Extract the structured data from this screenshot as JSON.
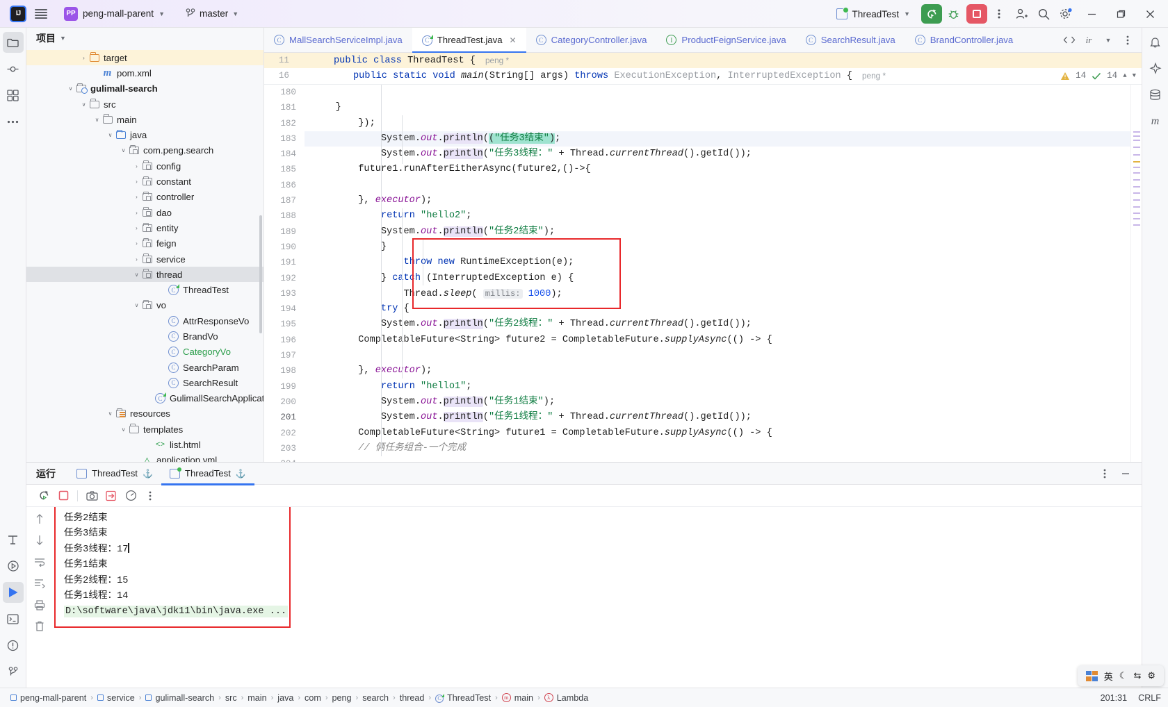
{
  "titlebar": {
    "logo": "IJ",
    "project": "peng-mall-parent",
    "branch": "master",
    "run_config": "ThreadTest",
    "icons": [
      "run-icon",
      "debug-icon",
      "stop-icon",
      "more-actions-icon",
      "add-user-icon",
      "search-icon",
      "settings-icon"
    ],
    "window": {
      "minimize": "─",
      "maximize": "❐",
      "close": "✕"
    }
  },
  "left_rail": {
    "items": [
      {
        "name": "project-tool-window",
        "glyph": "folder"
      },
      {
        "name": "commit-tool-window",
        "glyph": "commit"
      },
      {
        "name": "structure-tool-window",
        "glyph": "structure"
      },
      {
        "name": "more-tool-windows",
        "glyph": "dots"
      }
    ],
    "bottom_items": [
      {
        "name": "terminal-tool-window",
        "glyph": "T"
      },
      {
        "name": "services-tool-window",
        "glyph": "play-circle"
      },
      {
        "name": "run-tool-window",
        "glyph": "play-filled"
      },
      {
        "name": "debug-console",
        "glyph": "console"
      },
      {
        "name": "problems-tool-window",
        "glyph": "warn"
      },
      {
        "name": "git-tool-window",
        "glyph": "branch"
      }
    ]
  },
  "right_rail": {
    "items": [
      {
        "name": "notifications",
        "glyph": "bell"
      },
      {
        "name": "ai-assistant",
        "glyph": "ai"
      },
      {
        "name": "database-tool-window",
        "glyph": "db"
      },
      {
        "name": "maven-tool-window",
        "glyph": "m"
      }
    ]
  },
  "project_panel": {
    "title": "项目",
    "tree": [
      {
        "indent": 4,
        "arrow": "›",
        "icon": "folder-orange",
        "label": "target",
        "highlight": true
      },
      {
        "indent": 5,
        "arrow": "",
        "icon": "maven",
        "label": "pom.xml"
      },
      {
        "indent": 3,
        "arrow": "∨",
        "icon": "module",
        "label": "gulimall-search",
        "bold": true
      },
      {
        "indent": 4,
        "arrow": "∨",
        "icon": "folder",
        "label": "src"
      },
      {
        "indent": 5,
        "arrow": "∨",
        "icon": "folder",
        "label": "main"
      },
      {
        "indent": 6,
        "arrow": "∨",
        "icon": "folder-blue",
        "label": "java"
      },
      {
        "indent": 7,
        "arrow": "∨",
        "icon": "package",
        "label": "com.peng.search"
      },
      {
        "indent": 8,
        "arrow": "›",
        "icon": "package",
        "label": "config"
      },
      {
        "indent": 8,
        "arrow": "›",
        "icon": "package",
        "label": "constant"
      },
      {
        "indent": 8,
        "arrow": "›",
        "icon": "package",
        "label": "controller"
      },
      {
        "indent": 8,
        "arrow": "›",
        "icon": "package",
        "label": "dao"
      },
      {
        "indent": 8,
        "arrow": "›",
        "icon": "package",
        "label": "entity"
      },
      {
        "indent": 8,
        "arrow": "›",
        "icon": "package",
        "label": "feign"
      },
      {
        "indent": 8,
        "arrow": "›",
        "icon": "package",
        "label": "service"
      },
      {
        "indent": 8,
        "arrow": "∨",
        "icon": "package",
        "label": "thread",
        "selected": true
      },
      {
        "indent": 10,
        "arrow": "",
        "icon": "runnable-class",
        "label": "ThreadTest"
      },
      {
        "indent": 8,
        "arrow": "∨",
        "icon": "package",
        "label": "vo"
      },
      {
        "indent": 10,
        "arrow": "",
        "icon": "class",
        "label": "AttrResponseVo"
      },
      {
        "indent": 10,
        "arrow": "",
        "icon": "class",
        "label": "BrandVo"
      },
      {
        "indent": 10,
        "arrow": "",
        "icon": "class",
        "label": "CategoryVo",
        "green": true
      },
      {
        "indent": 10,
        "arrow": "",
        "icon": "class",
        "label": "SearchParam"
      },
      {
        "indent": 10,
        "arrow": "",
        "icon": "class",
        "label": "SearchResult"
      },
      {
        "indent": 9,
        "arrow": "",
        "icon": "spring-app",
        "label": "GulimallSearchApplication"
      },
      {
        "indent": 6,
        "arrow": "∨",
        "icon": "resources",
        "label": "resources"
      },
      {
        "indent": 7,
        "arrow": "∨",
        "icon": "folder",
        "label": "templates"
      },
      {
        "indent": 9,
        "arrow": "",
        "icon": "html",
        "label": "list.html"
      },
      {
        "indent": 8,
        "arrow": "",
        "icon": "yaml",
        "label": "application.yml"
      }
    ]
  },
  "editor": {
    "tabs": [
      {
        "label": "MallSearchServiceImpl.java",
        "icon": "class",
        "active": false
      },
      {
        "label": "ThreadTest.java",
        "icon": "runnable-class",
        "active": true,
        "closable": true
      },
      {
        "label": "CategoryController.java",
        "icon": "class",
        "active": false
      },
      {
        "label": "ProductFeignService.java",
        "icon": "interface",
        "active": false
      },
      {
        "label": "SearchResult.java",
        "icon": "class",
        "active": false
      },
      {
        "label": "BrandController.java",
        "icon": "class",
        "active": false
      }
    ],
    "sticky_lines": [
      {
        "num": "11",
        "text": "public class ThreadTest {",
        "author": "peng *"
      },
      {
        "num": "16",
        "text": "public static void main(String[] args) throws ExecutionException, InterruptedException {",
        "author": "peng *"
      }
    ],
    "inspections": {
      "warnings": "14",
      "checks": "14"
    },
    "lines": [
      {
        "num": "180",
        "html": ""
      },
      {
        "num": "181",
        "html": "        <span class=\"cmt\">// 俩任务组合-一个完成</span>"
      },
      {
        "num": "182",
        "html": "        CompletableFuture&lt;String&gt; future1 = CompletableFuture.<span class=\"mth-i\">supplyAsync</span>(() -&gt; {"
      },
      {
        "num": "183",
        "html": "            System.<span class=\"fld\">out</span>.<span class=\"hl-id\">println</span>(<span class=\"str\">\"任务1线程：\"</span> + Thread.<span class=\"mth-i\">currentThread</span>().getId());"
      },
      {
        "num": "184",
        "html": "            System.<span class=\"fld\">out</span>.<span class=\"hl-id\">println</span>(<span class=\"str\">\"任务1结束\"</span>);"
      },
      {
        "num": "185",
        "html": "            <span class=\"kw\">return</span> <span class=\"str\">\"hello1\"</span>;"
      },
      {
        "num": "186",
        "html": "        }, <span class=\"fld\">executor</span>);"
      },
      {
        "num": "187",
        "html": ""
      },
      {
        "num": "188",
        "html": "        CompletableFuture&lt;String&gt; future2 = CompletableFuture.<span class=\"mth-i\">supplyAsync</span>(() -&gt; {"
      },
      {
        "num": "189",
        "html": "            System.<span class=\"fld\">out</span>.<span class=\"hl-id\">println</span>(<span class=\"str\">\"任务2线程：\"</span> + Thread.<span class=\"mth-i\">currentThread</span>().getId());"
      },
      {
        "num": "190",
        "html": "            <span class=\"kw\">try</span> {"
      },
      {
        "num": "191",
        "html": "                Thread.<span class=\"mth-i\">sleep</span>( <span class=\"hint\">millis:</span> <span class=\"num\">1000</span>);"
      },
      {
        "num": "192",
        "html": "            } <span class=\"kw\">catch</span> (InterruptedException e) {"
      },
      {
        "num": "193",
        "html": "                <span class=\"kw\">throw new</span> RuntimeException(e);"
      },
      {
        "num": "194",
        "html": "            }"
      },
      {
        "num": "195",
        "html": "            System.<span class=\"fld\">out</span>.<span class=\"hl-id\">println</span>(<span class=\"str\">\"任务2结束\"</span>);"
      },
      {
        "num": "196",
        "html": "            <span class=\"kw\">return</span> <span class=\"str\">\"hello2\"</span>;"
      },
      {
        "num": "197",
        "html": "        }, <span class=\"fld\">executor</span>);"
      },
      {
        "num": "198",
        "html": ""
      },
      {
        "num": "199",
        "html": "        future1.runAfterEitherAsync(future2,()-&gt;{"
      },
      {
        "num": "200",
        "html": "            System.<span class=\"fld\">out</span>.<span class=\"hl-id\">println</span>(<span class=\"str\">\"任务3线程：\"</span> + Thread.<span class=\"mth-i\">currentThread</span>().getId());"
      },
      {
        "num": "201",
        "html": "            System.<span class=\"fld\">out</span>.<span class=\"hl-id\">println</span>(<span class=\"sel-txt\">(<span class=\"str\">\"任务3结束\"</span>)</span>;",
        "current": true
      },
      {
        "num": "202",
        "html": "        });"
      },
      {
        "num": "203",
        "html": "    }"
      },
      {
        "num": "204",
        "html": ""
      }
    ]
  },
  "run_panel": {
    "title": "运行",
    "tabs": [
      {
        "label": "ThreadTest",
        "active": false,
        "live": false
      },
      {
        "label": "ThreadTest",
        "active": true,
        "live": true
      }
    ],
    "toolbar_icons": [
      "rerun-icon",
      "stop-icon",
      "screenshot-icon",
      "export-icon",
      "profiler-icon",
      "more-icon"
    ],
    "console_rail_icons": [
      "scroll-up-icon",
      "scroll-down-icon",
      "soft-wrap-icon",
      "scroll-to-end-icon",
      "print-icon",
      "trash-icon"
    ],
    "console": [
      {
        "text": "D:\\software\\java\\jdk11\\bin\\java.exe ...",
        "cmd": true
      },
      {
        "text": "任务1线程：14"
      },
      {
        "text": "任务2线程：15"
      },
      {
        "text": "任务1结束"
      },
      {
        "text": "任务3线程：17",
        "caret": true
      },
      {
        "text": "任务3结束"
      },
      {
        "text": "任务2结束"
      }
    ]
  },
  "statusbar": {
    "breadcrumbs": [
      {
        "label": "peng-mall-parent",
        "icon": "module-blue"
      },
      {
        "label": "service",
        "icon": "module-blue"
      },
      {
        "label": "gulimall-search",
        "icon": "module-blue"
      },
      {
        "label": "src",
        "icon": "none"
      },
      {
        "label": "main",
        "icon": "none"
      },
      {
        "label": "java",
        "icon": "none"
      },
      {
        "label": "com",
        "icon": "none"
      },
      {
        "label": "peng",
        "icon": "none"
      },
      {
        "label": "search",
        "icon": "none"
      },
      {
        "label": "thread",
        "icon": "none"
      },
      {
        "label": "ThreadTest",
        "icon": "runnable-class"
      },
      {
        "label": "main",
        "icon": "method-red"
      },
      {
        "label": "Lambda",
        "icon": "lambda-red"
      }
    ],
    "caret_position": "201:31",
    "line_separator": "CRLF",
    "ime": {
      "lang": "英",
      "moon": "☾",
      "arrows": "⇆",
      "settings": "⚙"
    }
  },
  "colors": {
    "accent": "#3574f0",
    "run_green": "#3d9c51",
    "stop_red": "#e55765",
    "highlight_box": "#e8282b",
    "selection": "#9fe3d0",
    "keyword": "#0033b3",
    "string": "#0a7a3e",
    "number": "#1750eb",
    "field": "#871094",
    "comment": "#8c8c8c"
  }
}
